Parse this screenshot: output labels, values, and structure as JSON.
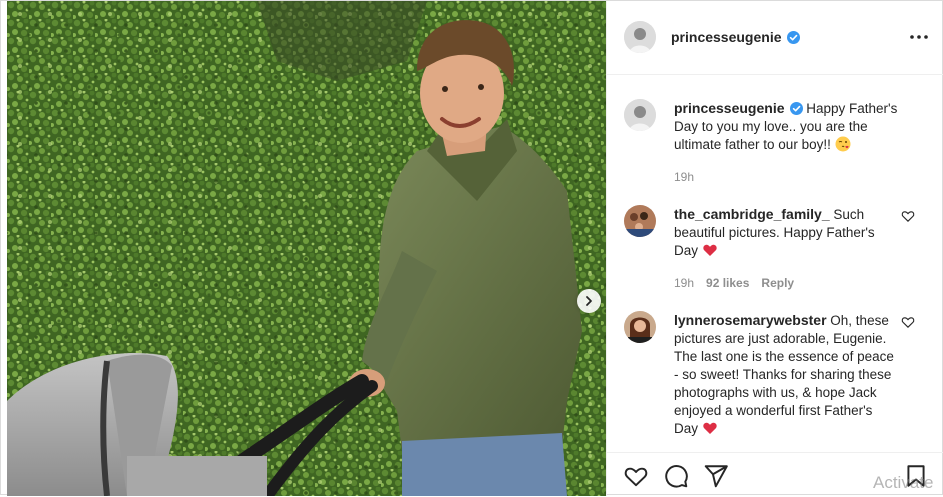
{
  "post": {
    "author": "princesseugenie",
    "verified": true
  },
  "caption": {
    "username": "princesseugenie",
    "text": "Happy Father's Day to you my love.. you are the ultimate father to our boy!!",
    "emoji": "kissing-face-wink",
    "time": "19h"
  },
  "comments": [
    {
      "username": "the_cambridge_family_",
      "text": "Such beautiful pictures. Happy Father's Day",
      "emoji": "red-heart",
      "time": "19h",
      "likes": "92 likes",
      "reply_label": "Reply"
    },
    {
      "username": "lynnerosemarywebster",
      "text": "Oh, these pictures are just adorable, Eugenie. The last one is the essence of peace - so sweet! Thanks for sharing these photographs with us, & hope Jack enjoyed a wonderful first Father's Day",
      "emoji": "red-heart"
    }
  ],
  "watermark": "Activate",
  "colors": {
    "verified_blue": "#3897f0",
    "heart_red": "#ed4956",
    "hedge_green": "#4f7a2c",
    "jacket_green": "#6b7a4a"
  },
  "icons": {
    "like": "heart-outline-icon",
    "comment": "speech-bubble-icon",
    "share": "paper-plane-icon",
    "save": "bookmark-icon",
    "more": "three-dots-icon",
    "next": "chevron-right-icon"
  }
}
